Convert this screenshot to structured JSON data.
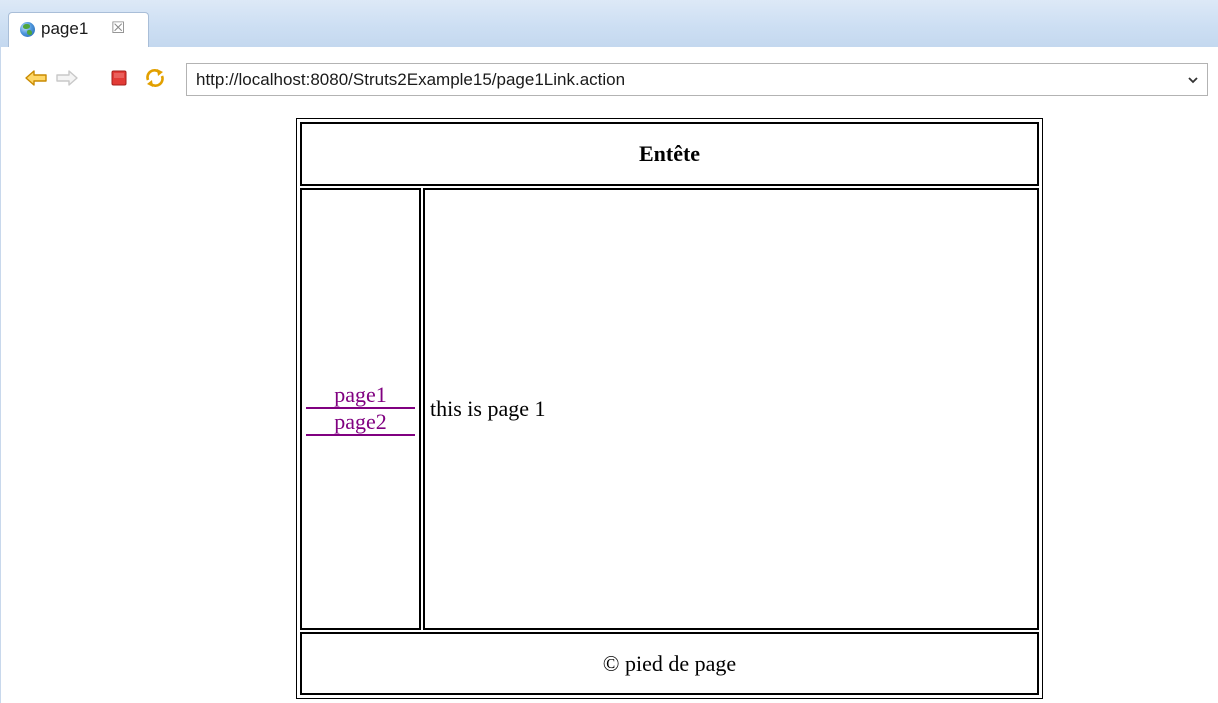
{
  "tab": {
    "title": "page1",
    "close_glyph": "☒"
  },
  "icons": {
    "tab": "globe-icon",
    "back": "back-arrow-icon",
    "forward": "forward-arrow-icon",
    "stop": "stop-icon",
    "refresh": "refresh-icon",
    "dropdown": "chevron-down-icon"
  },
  "address_bar": {
    "url": "http://localhost:8080/Struts2Example15/page1Link.action"
  },
  "page": {
    "header": "Entête",
    "menu_links": [
      "page1",
      "page2"
    ],
    "body_text": "this is page 1",
    "footer": "© pied de page"
  },
  "colors": {
    "link": "#800080",
    "nav_arrow": "#e8a400",
    "stop": "#d9302c",
    "tabstrip": "#cddff3"
  }
}
